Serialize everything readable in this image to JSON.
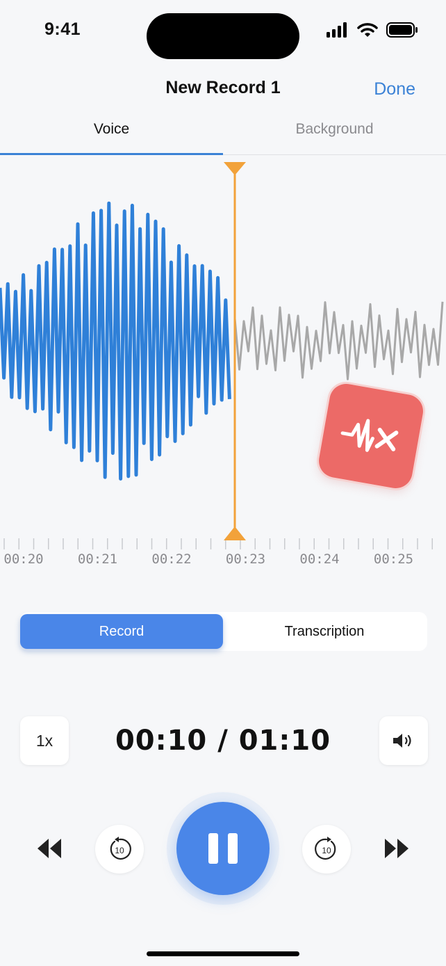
{
  "status": {
    "time": "9:41"
  },
  "nav": {
    "title": "New Record 1",
    "done_label": "Done"
  },
  "tabs": [
    {
      "label": "Voice",
      "selected": true
    },
    {
      "label": "Background",
      "selected": false
    }
  ],
  "timeline": {
    "labels": [
      "00:20",
      "00:21",
      "00:22",
      "00:23",
      "00:24",
      "00:25"
    ]
  },
  "segmented": {
    "record_label": "Record",
    "transcription_label": "Transcription",
    "selected": "Record"
  },
  "player": {
    "speed_label": "1x",
    "time_readout": "00:10 / 01:10",
    "skip_seconds": "10"
  },
  "icons": {
    "signal": "cellular-signal-icon",
    "wifi": "wifi-icon",
    "battery": "battery-icon",
    "mute": "waveform-mute-icon",
    "volume": "speaker-volume-icon",
    "previous": "previous-track-icon",
    "rewind": "rewind-10-icon",
    "pause": "pause-icon",
    "forward": "forward-10-icon",
    "next": "next-track-icon"
  },
  "colors": {
    "accent": "#4a86e8",
    "waveform_played": "#2f80d8",
    "waveform_unplayed": "#a8a8a8",
    "playhead": "#f2a23a",
    "mute_badge": "#ec6a67"
  }
}
